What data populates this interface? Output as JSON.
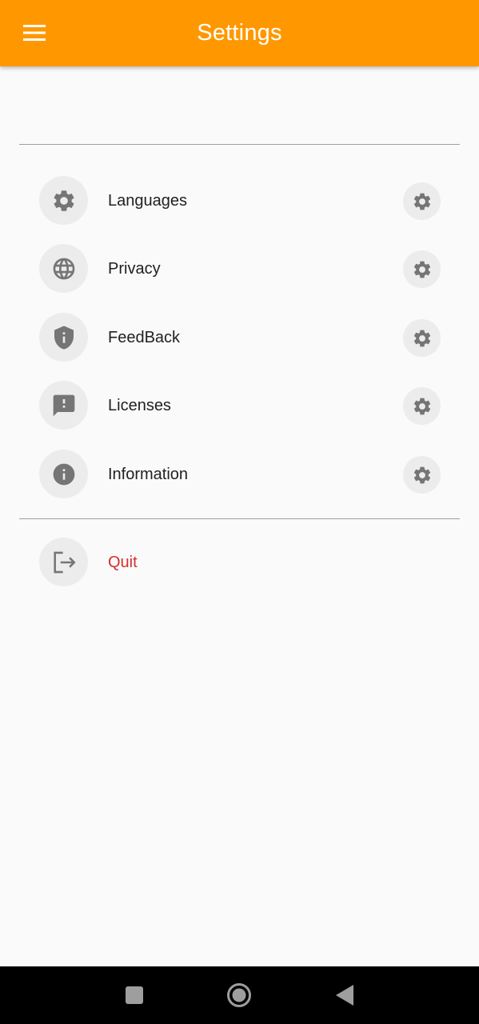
{
  "app_bar": {
    "title": "Settings",
    "menu_icon": "menu-icon",
    "color": "#ff9800"
  },
  "settings": {
    "items": [
      {
        "label": "Languages",
        "icon": "gear-icon",
        "action_icon": "gear-icon"
      },
      {
        "label": "Privacy",
        "icon": "globe-icon",
        "action_icon": "gear-icon"
      },
      {
        "label": "FeedBack",
        "icon": "shield-info-icon",
        "action_icon": "gear-icon"
      },
      {
        "label": "Licenses",
        "icon": "feedback-icon",
        "action_icon": "gear-icon"
      },
      {
        "label": "Information",
        "icon": "info-icon",
        "action_icon": "gear-icon"
      }
    ],
    "quit": {
      "label": "Quit",
      "icon": "logout-icon",
      "color": "#d32f2f"
    }
  },
  "system_nav": {
    "buttons": [
      "recents-icon",
      "home-icon",
      "back-icon"
    ]
  }
}
